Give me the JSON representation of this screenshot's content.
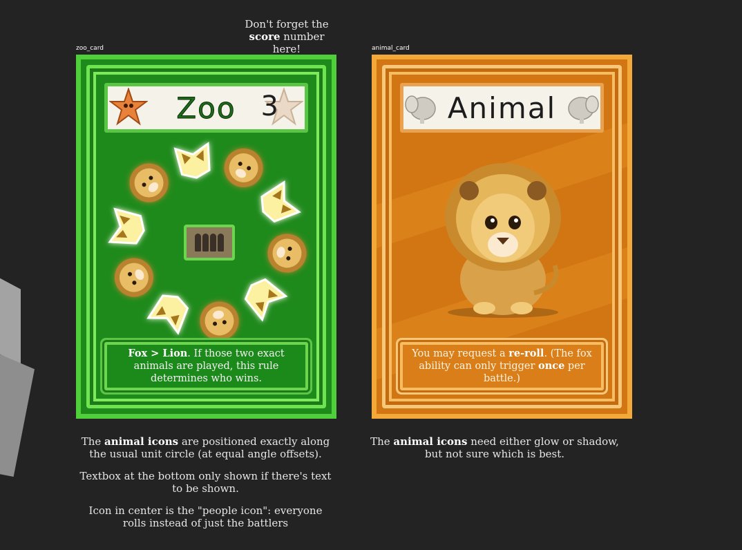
{
  "notes": {
    "score": {
      "line1": "Don't forget the",
      "bold": "score",
      "line2_rest": " number here!"
    },
    "zoo": [
      {
        "pre": "The ",
        "bold": "animal icons",
        "post": " are positioned exactly along the usual unit circle (at equal angle offsets)."
      },
      {
        "pre": "",
        "bold": "",
        "post": "Textbox at the bottom only shown if there's text to be shown."
      },
      {
        "pre": "",
        "bold": "",
        "post": "Icon in center is the \"people icon\": everyone rolls instead of just the battlers"
      }
    ],
    "animal": {
      "pre": "The ",
      "bold": "animal icons",
      "post": " need either glow or shadow, but not sure which is best."
    }
  },
  "cards": {
    "zoo": {
      "label": "zoo_card",
      "title": "Zoo",
      "score": "3",
      "colors": {
        "bg": "#1f8a1c",
        "border": "#4fcf3a"
      },
      "ring_icons": [
        "lion",
        "fox",
        "lion",
        "fox",
        "lion",
        "fox",
        "lion",
        "fox",
        "lion",
        "fox"
      ],
      "center_icon": "people-icon",
      "rule": {
        "b1": "Fox > Lion",
        "t1": ". If those two exact animals are played, this rule determines who wins."
      }
    },
    "animal": {
      "label": "animal_card",
      "title": "Animal",
      "colors": {
        "bg": "#d27513",
        "border": "#f2a93a"
      },
      "main_icon": "lion-icon",
      "rule": {
        "t0": "You may request a ",
        "b1": "re-roll",
        "t1": ". (The fox ability can only trigger ",
        "b2": "once",
        "t2": " per battle.)"
      }
    }
  }
}
